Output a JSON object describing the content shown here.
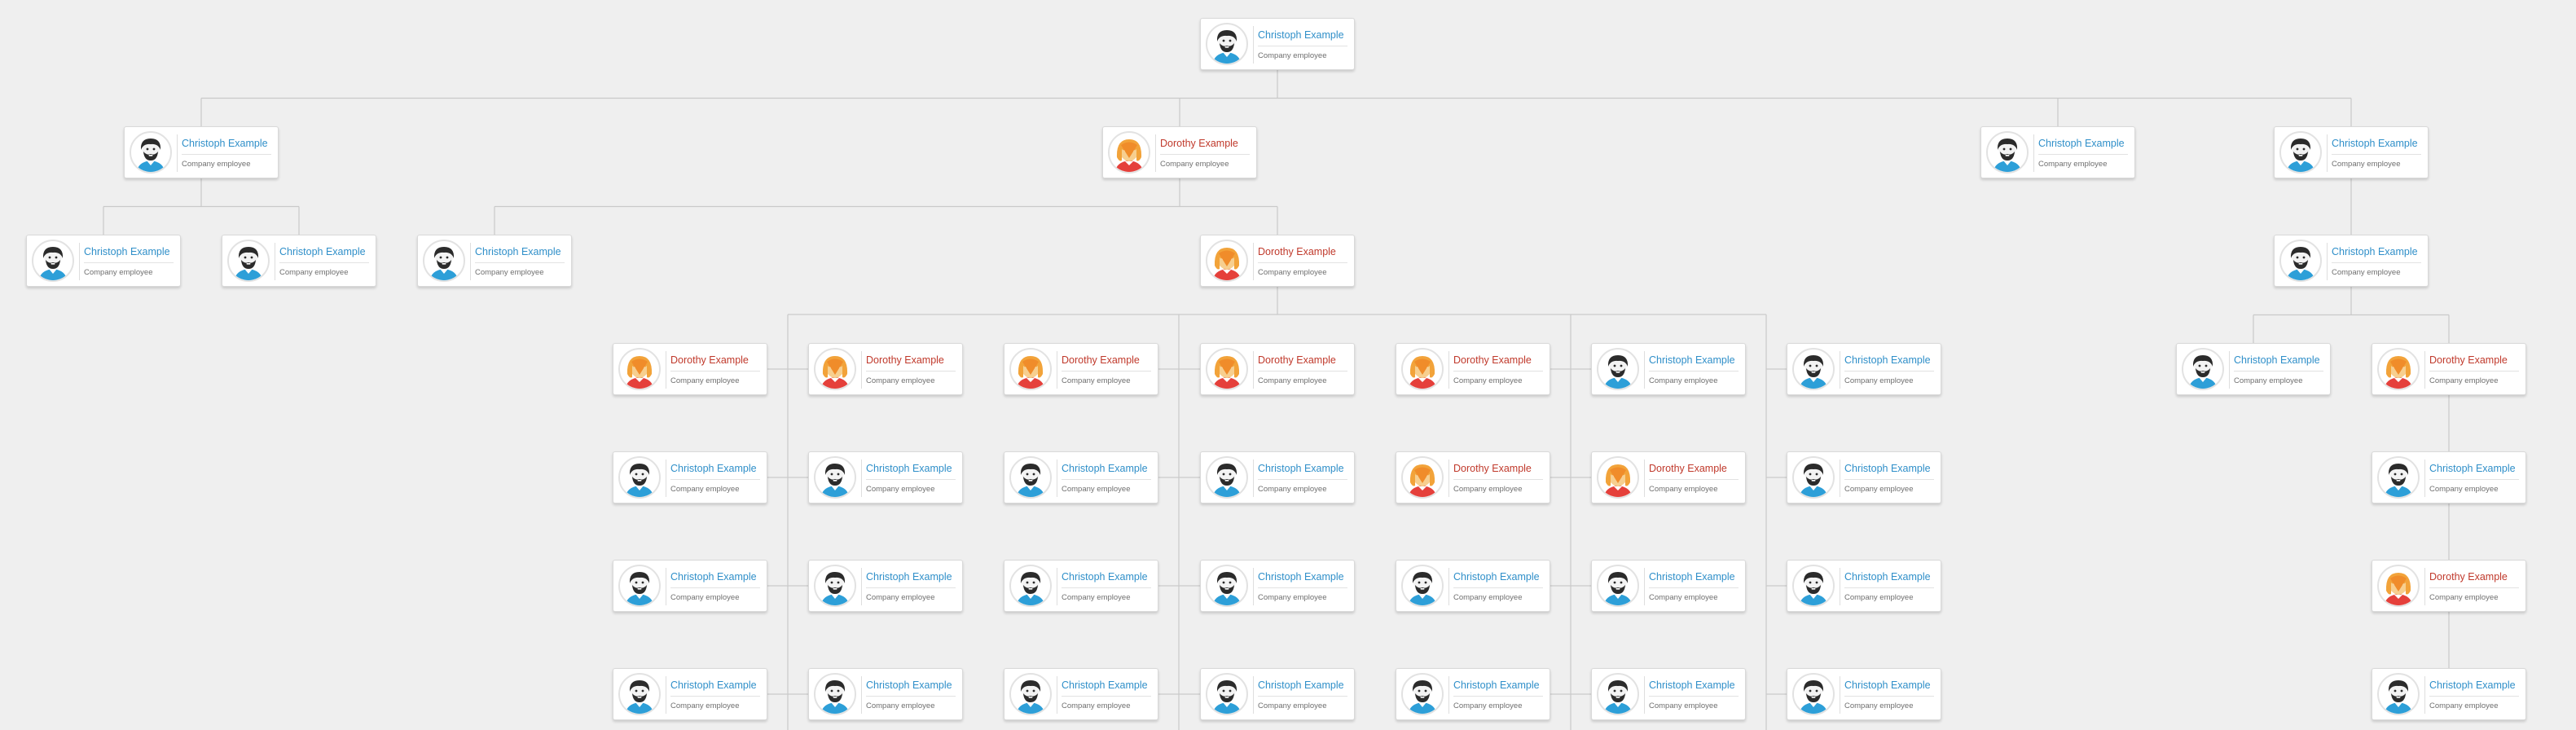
{
  "colors": {
    "background": "#efefef",
    "connector": "#c9c9c9",
    "name_male": "#2f8fc9",
    "name_female": "#c0392b"
  },
  "root": {
    "id": "n0",
    "name": "Christoph Example",
    "title": "Company employee",
    "avatar": "male-avatar-icon",
    "children": [
      {
        "id": "n1",
        "name": "Christoph Example",
        "title": "Company employee",
        "avatar": "male-avatar-icon",
        "children": [
          {
            "id": "n11",
            "name": "Christoph Example",
            "title": "Company employee",
            "avatar": "male-avatar-icon",
            "children": []
          },
          {
            "id": "n12",
            "name": "Christoph Example",
            "title": "Company employee",
            "avatar": "male-avatar-icon",
            "children": []
          }
        ]
      },
      {
        "id": "n2",
        "name": "Dorothy Example",
        "title": "Company employee",
        "avatar": "female-avatar-icon",
        "children": [
          {
            "id": "n21",
            "name": "Christoph Example",
            "title": "Company employee",
            "avatar": "male-avatar-icon",
            "children": []
          },
          {
            "id": "n22",
            "name": "Dorothy Example",
            "title": "Company employee",
            "avatar": "female-avatar-icon",
            "children": [
              {
                "id": "c1",
                "name": "Dorothy Example",
                "title": "Company employee",
                "avatar": "female-avatar-icon",
                "children": []
              },
              {
                "id": "c2",
                "name": "Dorothy Example",
                "title": "Company employee",
                "avatar": "female-avatar-icon",
                "children": []
              },
              {
                "id": "c3",
                "name": "Dorothy Example",
                "title": "Company employee",
                "avatar": "female-avatar-icon",
                "children": []
              },
              {
                "id": "c4",
                "name": "Dorothy Example",
                "title": "Company employee",
                "avatar": "female-avatar-icon",
                "children": []
              },
              {
                "id": "c5",
                "name": "Dorothy Example",
                "title": "Company employee",
                "avatar": "female-avatar-icon",
                "children": []
              },
              {
                "id": "c6",
                "name": "Christoph Example",
                "title": "Company employee",
                "avatar": "male-avatar-icon",
                "children": []
              },
              {
                "id": "c7",
                "name": "Christoph Example",
                "title": "Company employee",
                "avatar": "male-avatar-icon",
                "children": []
              },
              {
                "id": "c8",
                "name": "Christoph Example",
                "title": "Company employee",
                "avatar": "male-avatar-icon",
                "children": []
              },
              {
                "id": "c9",
                "name": "Christoph Example",
                "title": "Company employee",
                "avatar": "male-avatar-icon",
                "children": []
              },
              {
                "id": "c10",
                "name": "Christoph Example",
                "title": "Company employee",
                "avatar": "male-avatar-icon",
                "children": []
              },
              {
                "id": "c11",
                "name": "Christoph Example",
                "title": "Company employee",
                "avatar": "male-avatar-icon",
                "children": []
              },
              {
                "id": "c12",
                "name": "Dorothy Example",
                "title": "Company employee",
                "avatar": "female-avatar-icon",
                "children": []
              },
              {
                "id": "c13",
                "name": "Dorothy Example",
                "title": "Company employee",
                "avatar": "female-avatar-icon",
                "children": []
              },
              {
                "id": "c14",
                "name": "Christoph Example",
                "title": "Company employee",
                "avatar": "male-avatar-icon",
                "children": []
              },
              {
                "id": "c15",
                "name": "Christoph Example",
                "title": "Company employee",
                "avatar": "male-avatar-icon",
                "children": []
              },
              {
                "id": "c16",
                "name": "Christoph Example",
                "title": "Company employee",
                "avatar": "male-avatar-icon",
                "children": []
              },
              {
                "id": "c17",
                "name": "Christoph Example",
                "title": "Company employee",
                "avatar": "male-avatar-icon",
                "children": []
              },
              {
                "id": "c18",
                "name": "Christoph Example",
                "title": "Company employee",
                "avatar": "male-avatar-icon",
                "children": []
              },
              {
                "id": "c19",
                "name": "Christoph Example",
                "title": "Company employee",
                "avatar": "male-avatar-icon",
                "children": []
              },
              {
                "id": "c20",
                "name": "Christoph Example",
                "title": "Company employee",
                "avatar": "male-avatar-icon",
                "children": []
              },
              {
                "id": "c21",
                "name": "Christoph Example",
                "title": "Company employee",
                "avatar": "male-avatar-icon",
                "children": []
              },
              {
                "id": "c22",
                "name": "Christoph Example",
                "title": "Company employee",
                "avatar": "male-avatar-icon",
                "children": []
              },
              {
                "id": "c23",
                "name": "Christoph Example",
                "title": "Company employee",
                "avatar": "male-avatar-icon",
                "children": []
              },
              {
                "id": "c24",
                "name": "Christoph Example",
                "title": "Company employee",
                "avatar": "male-avatar-icon",
                "children": []
              },
              {
                "id": "c25",
                "name": "Christoph Example",
                "title": "Company employee",
                "avatar": "male-avatar-icon",
                "children": []
              },
              {
                "id": "c26",
                "name": "Christoph Example",
                "title": "Company employee",
                "avatar": "male-avatar-icon",
                "children": []
              },
              {
                "id": "c27",
                "name": "Christoph Example",
                "title": "Company employee",
                "avatar": "male-avatar-icon",
                "children": []
              },
              {
                "id": "c28",
                "name": "Christoph Example",
                "title": "Company employee",
                "avatar": "male-avatar-icon",
                "children": []
              }
            ]
          }
        ]
      },
      {
        "id": "n3",
        "name": "Christoph Example",
        "title": "Company employee",
        "avatar": "male-avatar-icon",
        "children": []
      },
      {
        "id": "n4",
        "name": "Christoph Example",
        "title": "Company employee",
        "avatar": "male-avatar-icon",
        "children": [
          {
            "id": "n41",
            "name": "Christoph Example",
            "title": "Company employee",
            "avatar": "male-avatar-icon",
            "children": [
              {
                "id": "n411",
                "name": "Christoph Example",
                "title": "Company employee",
                "avatar": "male-avatar-icon",
                "children": []
              },
              {
                "id": "n412",
                "name": "Dorothy Example",
                "title": "Company employee",
                "avatar": "female-avatar-icon",
                "children": [
                  {
                    "id": "n4121",
                    "name": "Christoph Example",
                    "title": "Company employee",
                    "avatar": "male-avatar-icon",
                    "children": [
                      {
                        "id": "n41211",
                        "name": "Dorothy Example",
                        "title": "Company employee",
                        "avatar": "female-avatar-icon",
                        "children": [
                          {
                            "id": "n412111",
                            "name": "Christoph Example",
                            "title": "Company employee",
                            "avatar": "male-avatar-icon",
                            "children": []
                          }
                        ]
                      }
                    ]
                  }
                ]
              }
            ]
          }
        ]
      }
    ]
  }
}
